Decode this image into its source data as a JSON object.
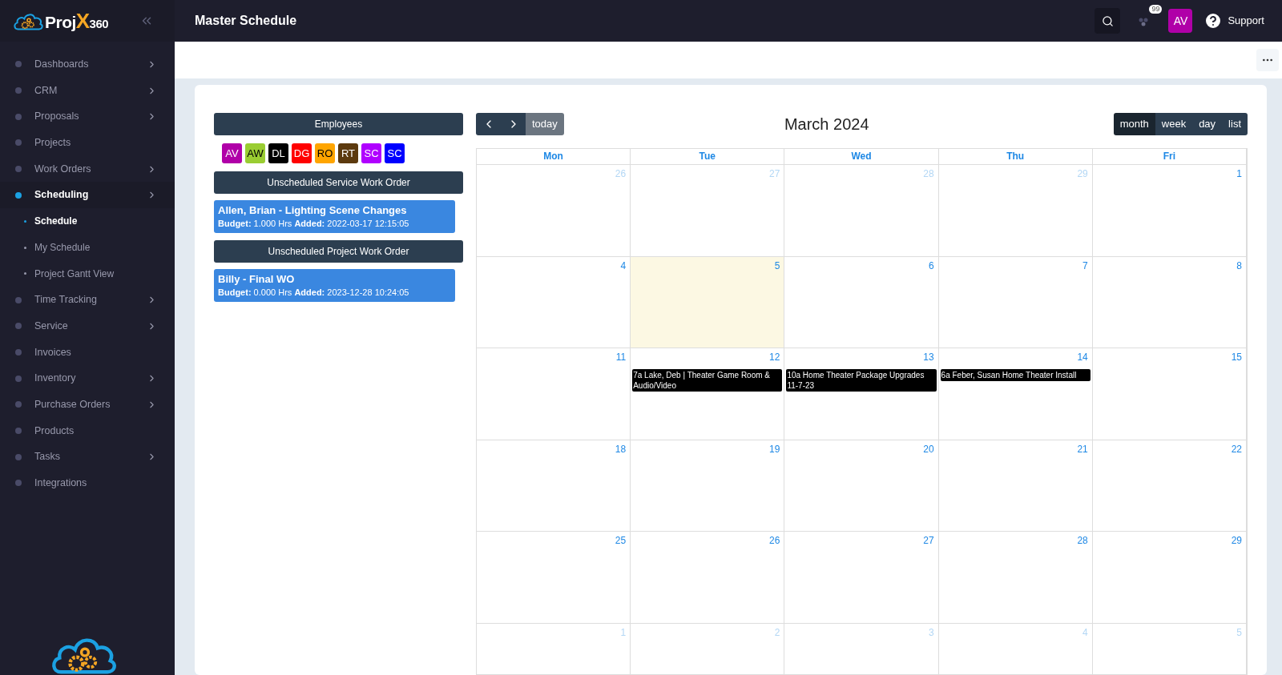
{
  "sidebar": {
    "logo": {
      "text": "Proj",
      "accent": "X",
      "suffix": "360"
    },
    "items": [
      {
        "label": "Dashboards",
        "has_submenu": true,
        "selected": false
      },
      {
        "label": "CRM",
        "has_submenu": true,
        "selected": false
      },
      {
        "label": "Proposals",
        "has_submenu": true,
        "selected": false
      },
      {
        "label": "Projects",
        "has_submenu": false,
        "selected": false
      },
      {
        "label": "Work Orders",
        "has_submenu": true,
        "selected": false
      },
      {
        "label": "Scheduling",
        "has_submenu": true,
        "selected": true,
        "children": [
          {
            "label": "Schedule",
            "selected": true
          },
          {
            "label": "My Schedule",
            "selected": false
          },
          {
            "label": "Project Gantt View",
            "selected": false
          }
        ]
      },
      {
        "label": "Time Tracking",
        "has_submenu": true,
        "selected": false
      },
      {
        "label": "Service",
        "has_submenu": true,
        "selected": false
      },
      {
        "label": "Invoices",
        "has_submenu": false,
        "selected": false
      },
      {
        "label": "Inventory",
        "has_submenu": true,
        "selected": false
      },
      {
        "label": "Purchase Orders",
        "has_submenu": true,
        "selected": false
      },
      {
        "label": "Products",
        "has_submenu": false,
        "selected": false
      },
      {
        "label": "Tasks",
        "has_submenu": true,
        "selected": false
      },
      {
        "label": "Integrations",
        "has_submenu": false,
        "selected": false
      }
    ]
  },
  "header": {
    "title": "Master Schedule",
    "notification_count": "99",
    "avatar": "AV",
    "support": "Support"
  },
  "employees": {
    "title": "Employees",
    "list": [
      {
        "initials": "AV",
        "color": "#b000a8"
      },
      {
        "initials": "AW",
        "color": "#9acd32"
      },
      {
        "initials": "DL",
        "color": "#000000"
      },
      {
        "initials": "DG",
        "color": "#ff0000"
      },
      {
        "initials": "RO",
        "color": "#ffa500"
      },
      {
        "initials": "RT",
        "color": "#5c3a0e"
      },
      {
        "initials": "SC",
        "color": "#b000ff"
      },
      {
        "initials": "SC",
        "color": "#0000ff"
      }
    ]
  },
  "sections": [
    {
      "title": "Unscheduled Service Work Order",
      "orders": [
        {
          "title": "Allen, Brian - Lighting Scene Changes",
          "budget_label": "Budget:",
          "budget": "1.000 Hrs",
          "added_label": "Added:",
          "added": "2022-03-17 12:15:05"
        }
      ]
    },
    {
      "title": "Unscheduled Project Work Order",
      "orders": [
        {
          "title": "Billy - Final WO",
          "budget_label": "Budget:",
          "budget": "0.000 Hrs",
          "added_label": "Added:",
          "added": "2023-12-28 10:24:05"
        }
      ]
    }
  ],
  "calendar": {
    "today_button": "today",
    "title": "March 2024",
    "views": [
      {
        "label": "month",
        "selected": true
      },
      {
        "label": "week",
        "selected": false
      },
      {
        "label": "day",
        "selected": false
      },
      {
        "label": "list",
        "selected": false
      }
    ],
    "weekdays": [
      "Mon",
      "Tue",
      "Wed",
      "Thu",
      "Fri"
    ],
    "weeks": [
      [
        {
          "day": "26",
          "other_month": true,
          "today": false
        },
        {
          "day": "27",
          "other_month": true,
          "today": false
        },
        {
          "day": "28",
          "other_month": true,
          "today": false
        },
        {
          "day": "29",
          "other_month": true,
          "today": false
        },
        {
          "day": "1",
          "other_month": false,
          "today": false
        }
      ],
      [
        {
          "day": "4",
          "other_month": false,
          "today": false
        },
        {
          "day": "5",
          "other_month": false,
          "today": true
        },
        {
          "day": "6",
          "other_month": false,
          "today": false
        },
        {
          "day": "7",
          "other_month": false,
          "today": false
        },
        {
          "day": "8",
          "other_month": false,
          "today": false
        }
      ],
      [
        {
          "day": "11",
          "other_month": false,
          "today": false
        },
        {
          "day": "12",
          "other_month": false,
          "today": false,
          "events": [
            "7a Lake, Deb | Theater Game Room & Audio/Video"
          ]
        },
        {
          "day": "13",
          "other_month": false,
          "today": false,
          "events": [
            "10a Home Theater Package Upgrades 11-7-23"
          ]
        },
        {
          "day": "14",
          "other_month": false,
          "today": false,
          "events": [
            "6a Feber, Susan Home Theater Install"
          ]
        },
        {
          "day": "15",
          "other_month": false,
          "today": false
        }
      ],
      [
        {
          "day": "18",
          "other_month": false,
          "today": false
        },
        {
          "day": "19",
          "other_month": false,
          "today": false
        },
        {
          "day": "20",
          "other_month": false,
          "today": false
        },
        {
          "day": "21",
          "other_month": false,
          "today": false
        },
        {
          "day": "22",
          "other_month": false,
          "today": false
        }
      ],
      [
        {
          "day": "25",
          "other_month": false,
          "today": false
        },
        {
          "day": "26",
          "other_month": false,
          "today": false
        },
        {
          "day": "27",
          "other_month": false,
          "today": false
        },
        {
          "day": "28",
          "other_month": false,
          "today": false
        },
        {
          "day": "29",
          "other_month": false,
          "today": false
        }
      ],
      [
        {
          "day": "1",
          "other_month": true,
          "today": false
        },
        {
          "day": "2",
          "other_month": true,
          "today": false
        },
        {
          "day": "3",
          "other_month": true,
          "today": false
        },
        {
          "day": "4",
          "other_month": true,
          "today": false
        },
        {
          "day": "5",
          "other_month": true,
          "today": false
        }
      ]
    ]
  }
}
